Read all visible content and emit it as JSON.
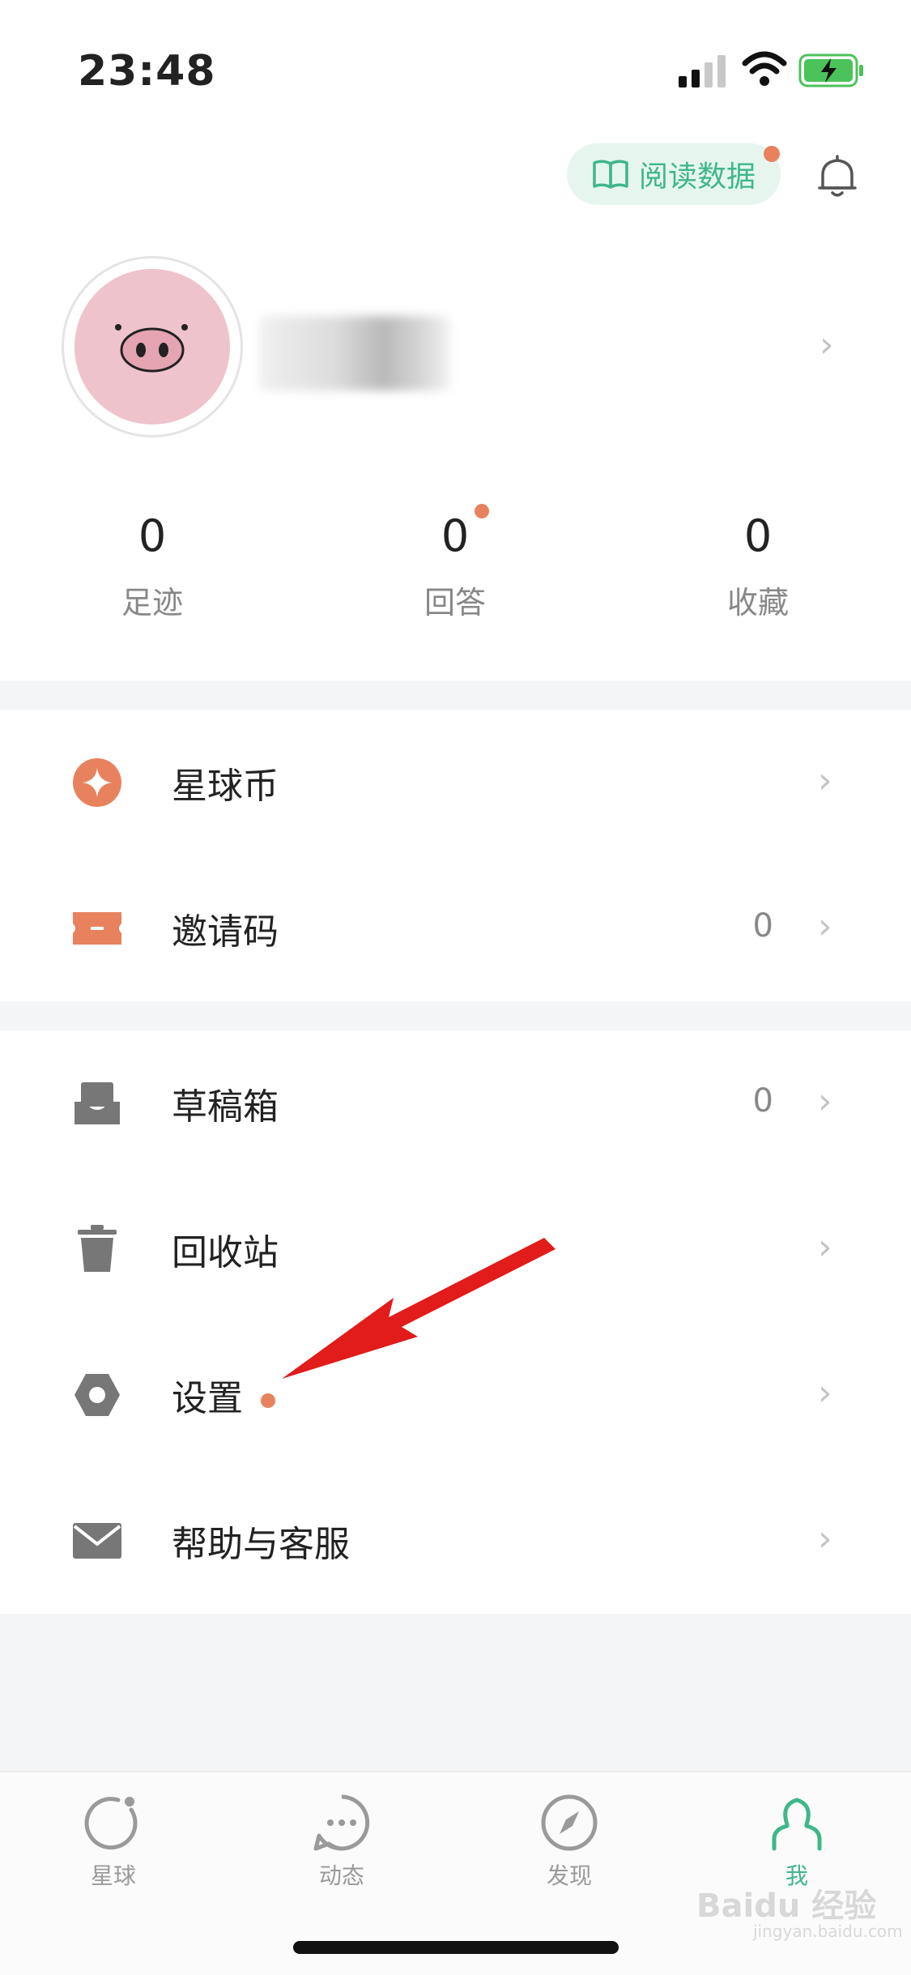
{
  "status_bar": {
    "time": "23:48"
  },
  "header": {
    "read_data_label": "阅读数据"
  },
  "stats": [
    {
      "value": "0",
      "label": "足迹"
    },
    {
      "value": "0",
      "label": "回答"
    },
    {
      "value": "0",
      "label": "收藏"
    }
  ],
  "menu": {
    "coins": {
      "label": "星球币"
    },
    "invite": {
      "label": "邀请码",
      "value": "0"
    },
    "drafts": {
      "label": "草稿箱",
      "value": "0"
    },
    "recycle": {
      "label": "回收站"
    },
    "settings": {
      "label": "设置"
    },
    "help": {
      "label": "帮助与客服"
    }
  },
  "tabs": [
    {
      "label": "星球"
    },
    {
      "label": "动态"
    },
    {
      "label": "发现"
    },
    {
      "label": "我"
    }
  ],
  "watermark": {
    "brand": "Baidu 经验",
    "site": "jingyan.baidu.com"
  },
  "colors": {
    "accent_green": "#3fb78a",
    "accent_orange": "#e8825e",
    "icon_gray": "#777777"
  }
}
